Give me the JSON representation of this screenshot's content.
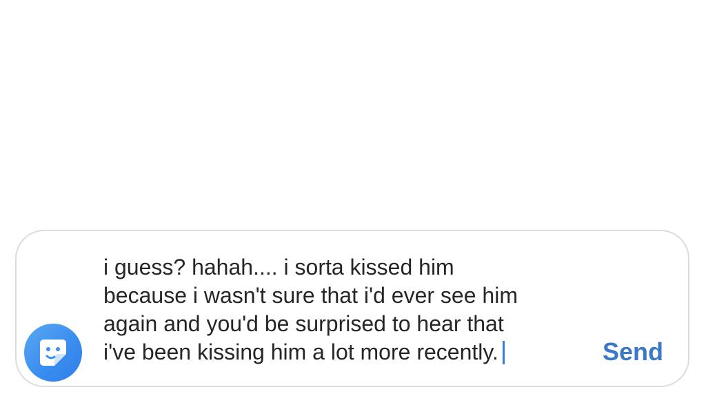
{
  "composer": {
    "sticker_icon": "sticker-smile-icon",
    "message_lines": [
      "i guess? hahah.... i sorta kissed him",
      "because i wasn't sure that i'd ever see him",
      "again and you'd be surprised to hear that",
      "i've been kissing him a lot more recently."
    ],
    "send_label": "Send"
  },
  "colors": {
    "send": "#3b79c7",
    "caret": "#3d7bd9",
    "sticker_bg": "#3b8ef0",
    "border": "#dcdcdc"
  }
}
